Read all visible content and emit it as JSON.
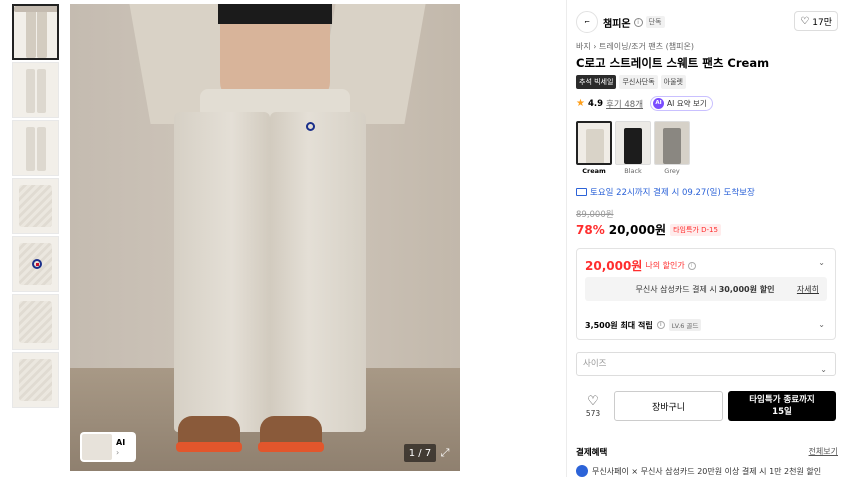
{
  "gallery": {
    "counter": "1 / 7",
    "ai_chip_label": "AI",
    "ai_chip_arrow": "›",
    "expand_icon": "⤢"
  },
  "brand": {
    "logo_text": "⌐",
    "name": "챔피온",
    "info_icon": "i",
    "badge": "단독",
    "likes": "17만"
  },
  "breadcrumb": "바지 › 트레이닝/조거 팬츠 (챔피온)",
  "title": "C로고 스트레이트 스웨트 팬츠 Cream",
  "tags": [
    "추석 빅세일",
    "무신사단독",
    "아울렛"
  ],
  "rating": {
    "score": "4.9",
    "reviews": "후기 48개",
    "ai_summary": "AI 요약 보기",
    "ai_icon": "AI"
  },
  "colors": [
    {
      "name": "Cream",
      "hex": "#d9d3c8",
      "selected": true
    },
    {
      "name": "Black",
      "hex": "#1c1c1c",
      "selected": false
    },
    {
      "name": "Grey",
      "hex": "#8a8781",
      "selected": false
    }
  ],
  "delivery": "토요일 22시까지 결제 시 09.27(일) 도착보장",
  "pricing": {
    "original": "89,000원",
    "discount": "78%",
    "price": "20,000원",
    "timesale_badge": "타임특가 D-15"
  },
  "benefits": {
    "my_price": "20,000원",
    "my_price_label": "나의 할인가",
    "card_text_prefix": "무신사 삼성카드 결제 시",
    "card_amount": "30,000원 할인",
    "card_detail": "자세히",
    "points": "3,500원 최대 적립",
    "level": "LV.6 골드"
  },
  "size_select": {
    "placeholder": "사이즈"
  },
  "actions": {
    "wish_count": "573",
    "cart": "장바구니",
    "buy_line1": "타임특가 종료까지",
    "buy_line2": "15일"
  },
  "payment": {
    "title": "결제혜택",
    "all": "전체보기",
    "row_text": "무신사페이 × 무신사 삼성카드 20만원 이상 결제 시 1만 2천원 할인"
  },
  "accent_colors": {
    "red": "#ff2e2e",
    "blue": "#2c63d8",
    "star": "#ff9f1a"
  }
}
